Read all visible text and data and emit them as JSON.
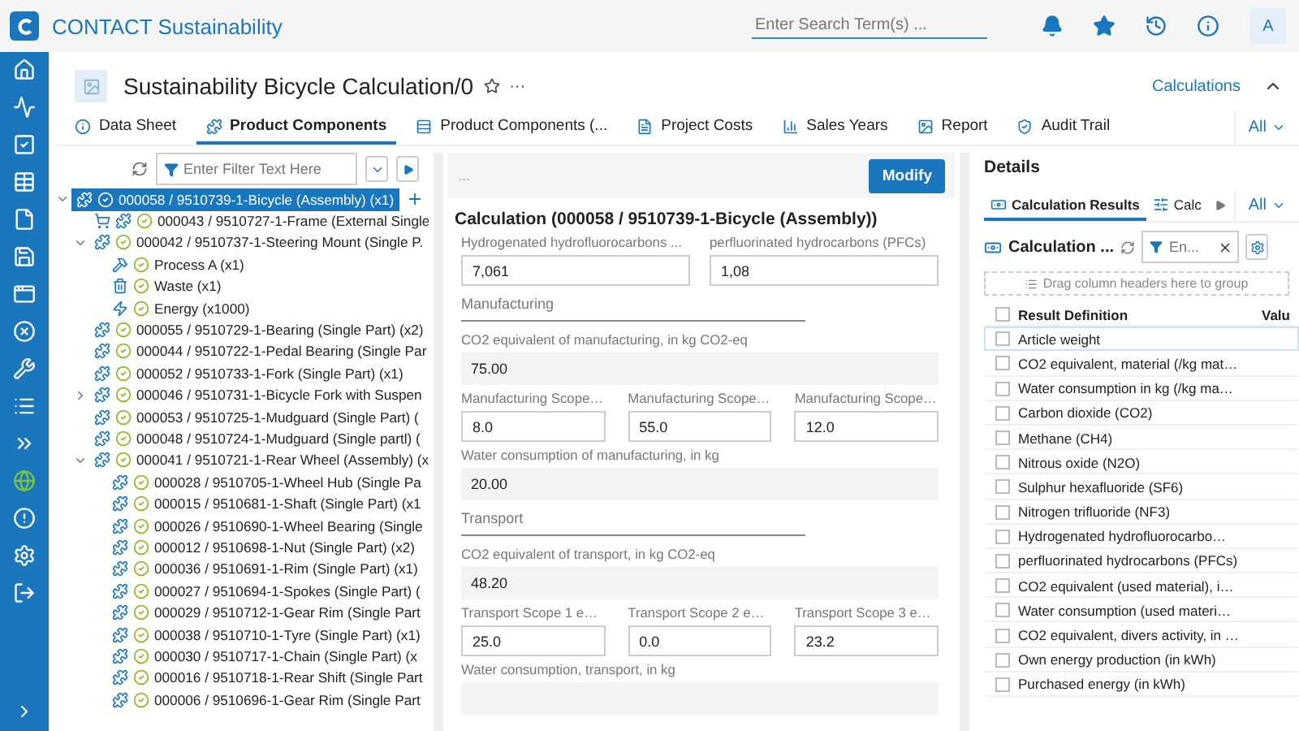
{
  "app": {
    "name": "CONTACT Sustainability",
    "search_placeholder": "Enter Search Term(s) ...",
    "avatar": "A"
  },
  "page": {
    "title": "Sustainability Bicycle Calculation/0",
    "context_link": "Calculations",
    "more": "···"
  },
  "tabs": [
    {
      "label": "Data Sheet",
      "selected": false
    },
    {
      "label": "Product Components",
      "selected": true
    },
    {
      "label": "Product Components (...",
      "selected": false
    },
    {
      "label": "Project Costs",
      "selected": false
    },
    {
      "label": "Sales Years",
      "selected": false
    },
    {
      "label": "Report",
      "selected": false
    },
    {
      "label": "Audit Trail",
      "selected": false
    }
  ],
  "tabs_menu": "All",
  "tree": {
    "filter_placeholder": "Enter Filter Text Here",
    "items": [
      {
        "label": "000058 / 9510739-1-Bicycle (Assembly) (x1)",
        "kind": "part",
        "selected": true,
        "expanded": true,
        "children": [
          {
            "label": "000043 / 9510727-1-Frame (External Single",
            "kind": "purchased",
            "selected": false
          },
          {
            "label": "000042 / 9510737-1-Steering Mount (Single P.",
            "kind": "part",
            "selected": false,
            "expanded": true,
            "children": [
              {
                "label": "Process A (x1)",
                "kind": "process",
                "selected": false
              },
              {
                "label": "Waste (x1)",
                "kind": "waste",
                "selected": false
              },
              {
                "label": "Energy (x1000)",
                "kind": "energy",
                "selected": false
              }
            ]
          },
          {
            "label": "000055 / 9510729-1-Bearing (Single Part) (x2)",
            "kind": "part",
            "selected": false
          },
          {
            "label": "000044 / 9510722-1-Pedal Bearing (Single Par",
            "kind": "part",
            "selected": false
          },
          {
            "label": "000052 / 9510733-1-Fork (Single Part) (x1)",
            "kind": "part",
            "selected": false
          },
          {
            "label": "000046 / 9510731-1-Bicycle Fork with Suspen",
            "kind": "part",
            "selected": false,
            "expanded": false
          },
          {
            "label": "000053 / 9510725-1-Mudguard (Single Part) (",
            "kind": "part",
            "selected": false
          },
          {
            "label": "000048 / 9510724-1-Mudguard (Single partl) (",
            "kind": "part",
            "selected": false
          },
          {
            "label": "000041 / 9510721-1-Rear Wheel (Assembly) (x",
            "kind": "part",
            "selected": false,
            "expanded": true,
            "children": [
              {
                "label": "000028 / 9510705-1-Wheel Hub (Single Pa",
                "kind": "subpart",
                "selected": false
              },
              {
                "label": "000015 / 9510681-1-Shaft (Single Part) (x1",
                "kind": "subpart",
                "selected": false
              },
              {
                "label": "000026 / 9510690-1-Wheel Bearing (Single",
                "kind": "subpart",
                "selected": false
              },
              {
                "label": "000012 / 9510698-1-Nut (Single Part) (x2)",
                "kind": "subpart",
                "selected": false
              },
              {
                "label": "000036 / 9510691-1-Rim (Single Part) (x1)",
                "kind": "subpart",
                "selected": false
              },
              {
                "label": "000027 / 9510694-1-Spokes (Single Part) (",
                "kind": "subpart",
                "selected": false
              },
              {
                "label": "000029 / 9510712-1-Gear Rim (Single Part",
                "kind": "subpart",
                "selected": false
              },
              {
                "label": "000038 / 9510710-1-Tyre (Single Part) (x1)",
                "kind": "subpart",
                "selected": false
              },
              {
                "label": "000030 / 9510717-1-Chain (Single Part) (x",
                "kind": "subpart",
                "selected": false
              },
              {
                "label": "000016 / 9510718-1-Rear Shift (Single Part",
                "kind": "subpart",
                "selected": false
              },
              {
                "label": "000006 / 9510696-1-Gear Rim (Single Part",
                "kind": "subpart",
                "selected": false
              }
            ]
          }
        ]
      }
    ]
  },
  "calculation": {
    "toolbar_text": "...",
    "modify_button": "Modify",
    "title": "Calculation (000058 / 9510739-1-Bicycle (Assembly))",
    "blocks": [
      {
        "kind": "fields",
        "fields": [
          {
            "label": "Hydrogenated hydrofluorocarbons ...",
            "value": "7,061"
          },
          {
            "label": "perfluorinated hydrocarbons (PFCs)",
            "value": "1,08"
          }
        ]
      },
      {
        "kind": "section",
        "title": "Manufacturing"
      },
      {
        "kind": "readonly",
        "label": "CO2 equivalent of manufacturing, in kg CO2-eq",
        "value": "75.00"
      },
      {
        "kind": "fields",
        "fields": [
          {
            "label": "Manufacturing Scope…",
            "value": "8.0"
          },
          {
            "label": "Manufacturing Scope…",
            "value": "55.0"
          },
          {
            "label": "Manufacturing Scope…",
            "value": "12.0"
          }
        ]
      },
      {
        "kind": "readonly",
        "label": "Water consumption of manufacturing, in kg",
        "value": "20.00"
      },
      {
        "kind": "section",
        "title": "Transport"
      },
      {
        "kind": "readonly",
        "label": "CO2 equivalent of transport, in kg CO2-eq",
        "value": "48.20"
      },
      {
        "kind": "fields",
        "fields": [
          {
            "label": "Transport Scope 1 e…",
            "value": "25.0"
          },
          {
            "label": "Transport Scope 2 e…",
            "value": "0.0"
          },
          {
            "label": "Transport Scope 3 e…",
            "value": "23.2"
          }
        ]
      },
      {
        "kind": "readonly",
        "label": "Water consumption, transport, in kg"
      }
    ]
  },
  "details": {
    "title": "Details",
    "tabs": [
      {
        "label": "Calculation Results",
        "selected": true
      },
      {
        "label": "Calc",
        "selected": false
      }
    ],
    "tabs_menu": "All",
    "table_title": "Calculation ...",
    "filter_placeholder": "En...",
    "group_hint": "Drag column headers here to group",
    "columns": [
      "Result Definition",
      "Valu"
    ],
    "select_all_checked": false,
    "rows": [
      {
        "name": "Article weight",
        "checked": false,
        "focused": true
      },
      {
        "name": "CO2 equivalent, material (/kg mat…",
        "checked": false,
        "focused": false
      },
      {
        "name": "Water consumption in kg (/kg ma…",
        "checked": false,
        "focused": false
      },
      {
        "name": "Carbon dioxide (CO2)",
        "checked": false,
        "focused": false
      },
      {
        "name": "Methane (CH4)",
        "checked": false,
        "focused": false
      },
      {
        "name": "Nitrous oxide (N2O)",
        "checked": false,
        "focused": false
      },
      {
        "name": "Sulphur hexafluoride (SF6)",
        "checked": false,
        "focused": false
      },
      {
        "name": "Nitrogen trifluoride (NF3)",
        "checked": false,
        "focused": false
      },
      {
        "name": "Hydrogenated hydrofluorocarbo…",
        "checked": false,
        "focused": false
      },
      {
        "name": "perfluorinated hydrocarbons (PFCs)",
        "checked": false,
        "focused": false
      },
      {
        "name": "CO2 equivalent (used material), i…",
        "checked": false,
        "focused": false
      },
      {
        "name": "Water consumption (used materi…",
        "checked": false,
        "focused": false
      },
      {
        "name": "CO2 equivalent, divers activity, in …",
        "checked": false,
        "focused": false
      },
      {
        "name": "Own energy production (in kWh)",
        "checked": false,
        "focused": false
      },
      {
        "name": "Purchased energy (in kWh)",
        "checked": false,
        "focused": false
      }
    ]
  }
}
